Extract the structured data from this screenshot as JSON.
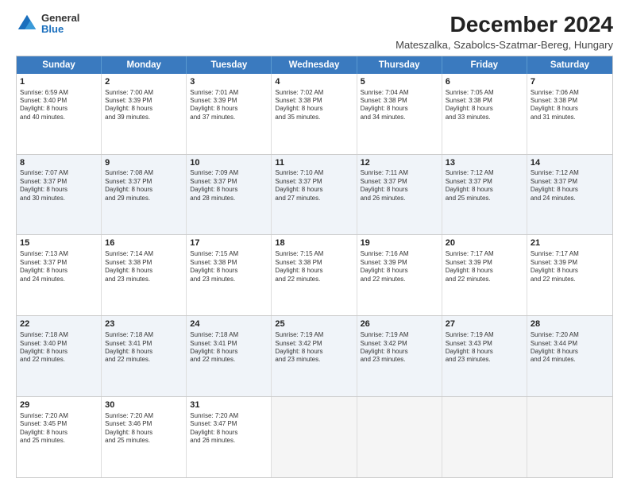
{
  "logo": {
    "general": "General",
    "blue": "Blue"
  },
  "title": "December 2024",
  "subtitle": "Mateszalka, Szabolcs-Szatmar-Bereg, Hungary",
  "calendar": {
    "headers": [
      "Sunday",
      "Monday",
      "Tuesday",
      "Wednesday",
      "Thursday",
      "Friday",
      "Saturday"
    ],
    "weeks": [
      [
        {
          "day": "1",
          "lines": [
            "Sunrise: 6:59 AM",
            "Sunset: 3:40 PM",
            "Daylight: 8 hours",
            "and 40 minutes."
          ]
        },
        {
          "day": "2",
          "lines": [
            "Sunrise: 7:00 AM",
            "Sunset: 3:39 PM",
            "Daylight: 8 hours",
            "and 39 minutes."
          ]
        },
        {
          "day": "3",
          "lines": [
            "Sunrise: 7:01 AM",
            "Sunset: 3:39 PM",
            "Daylight: 8 hours",
            "and 37 minutes."
          ]
        },
        {
          "day": "4",
          "lines": [
            "Sunrise: 7:02 AM",
            "Sunset: 3:38 PM",
            "Daylight: 8 hours",
            "and 35 minutes."
          ]
        },
        {
          "day": "5",
          "lines": [
            "Sunrise: 7:04 AM",
            "Sunset: 3:38 PM",
            "Daylight: 8 hours",
            "and 34 minutes."
          ]
        },
        {
          "day": "6",
          "lines": [
            "Sunrise: 7:05 AM",
            "Sunset: 3:38 PM",
            "Daylight: 8 hours",
            "and 33 minutes."
          ]
        },
        {
          "day": "7",
          "lines": [
            "Sunrise: 7:06 AM",
            "Sunset: 3:38 PM",
            "Daylight: 8 hours",
            "and 31 minutes."
          ]
        }
      ],
      [
        {
          "day": "8",
          "lines": [
            "Sunrise: 7:07 AM",
            "Sunset: 3:37 PM",
            "Daylight: 8 hours",
            "and 30 minutes."
          ]
        },
        {
          "day": "9",
          "lines": [
            "Sunrise: 7:08 AM",
            "Sunset: 3:37 PM",
            "Daylight: 8 hours",
            "and 29 minutes."
          ]
        },
        {
          "day": "10",
          "lines": [
            "Sunrise: 7:09 AM",
            "Sunset: 3:37 PM",
            "Daylight: 8 hours",
            "and 28 minutes."
          ]
        },
        {
          "day": "11",
          "lines": [
            "Sunrise: 7:10 AM",
            "Sunset: 3:37 PM",
            "Daylight: 8 hours",
            "and 27 minutes."
          ]
        },
        {
          "day": "12",
          "lines": [
            "Sunrise: 7:11 AM",
            "Sunset: 3:37 PM",
            "Daylight: 8 hours",
            "and 26 minutes."
          ]
        },
        {
          "day": "13",
          "lines": [
            "Sunrise: 7:12 AM",
            "Sunset: 3:37 PM",
            "Daylight: 8 hours",
            "and 25 minutes."
          ]
        },
        {
          "day": "14",
          "lines": [
            "Sunrise: 7:12 AM",
            "Sunset: 3:37 PM",
            "Daylight: 8 hours",
            "and 24 minutes."
          ]
        }
      ],
      [
        {
          "day": "15",
          "lines": [
            "Sunrise: 7:13 AM",
            "Sunset: 3:37 PM",
            "Daylight: 8 hours",
            "and 24 minutes."
          ]
        },
        {
          "day": "16",
          "lines": [
            "Sunrise: 7:14 AM",
            "Sunset: 3:38 PM",
            "Daylight: 8 hours",
            "and 23 minutes."
          ]
        },
        {
          "day": "17",
          "lines": [
            "Sunrise: 7:15 AM",
            "Sunset: 3:38 PM",
            "Daylight: 8 hours",
            "and 23 minutes."
          ]
        },
        {
          "day": "18",
          "lines": [
            "Sunrise: 7:15 AM",
            "Sunset: 3:38 PM",
            "Daylight: 8 hours",
            "and 22 minutes."
          ]
        },
        {
          "day": "19",
          "lines": [
            "Sunrise: 7:16 AM",
            "Sunset: 3:39 PM",
            "Daylight: 8 hours",
            "and 22 minutes."
          ]
        },
        {
          "day": "20",
          "lines": [
            "Sunrise: 7:17 AM",
            "Sunset: 3:39 PM",
            "Daylight: 8 hours",
            "and 22 minutes."
          ]
        },
        {
          "day": "21",
          "lines": [
            "Sunrise: 7:17 AM",
            "Sunset: 3:39 PM",
            "Daylight: 8 hours",
            "and 22 minutes."
          ]
        }
      ],
      [
        {
          "day": "22",
          "lines": [
            "Sunrise: 7:18 AM",
            "Sunset: 3:40 PM",
            "Daylight: 8 hours",
            "and 22 minutes."
          ]
        },
        {
          "day": "23",
          "lines": [
            "Sunrise: 7:18 AM",
            "Sunset: 3:41 PM",
            "Daylight: 8 hours",
            "and 22 minutes."
          ]
        },
        {
          "day": "24",
          "lines": [
            "Sunrise: 7:18 AM",
            "Sunset: 3:41 PM",
            "Daylight: 8 hours",
            "and 22 minutes."
          ]
        },
        {
          "day": "25",
          "lines": [
            "Sunrise: 7:19 AM",
            "Sunset: 3:42 PM",
            "Daylight: 8 hours",
            "and 23 minutes."
          ]
        },
        {
          "day": "26",
          "lines": [
            "Sunrise: 7:19 AM",
            "Sunset: 3:42 PM",
            "Daylight: 8 hours",
            "and 23 minutes."
          ]
        },
        {
          "day": "27",
          "lines": [
            "Sunrise: 7:19 AM",
            "Sunset: 3:43 PM",
            "Daylight: 8 hours",
            "and 23 minutes."
          ]
        },
        {
          "day": "28",
          "lines": [
            "Sunrise: 7:20 AM",
            "Sunset: 3:44 PM",
            "Daylight: 8 hours",
            "and 24 minutes."
          ]
        }
      ],
      [
        {
          "day": "29",
          "lines": [
            "Sunrise: 7:20 AM",
            "Sunset: 3:45 PM",
            "Daylight: 8 hours",
            "and 25 minutes."
          ]
        },
        {
          "day": "30",
          "lines": [
            "Sunrise: 7:20 AM",
            "Sunset: 3:46 PM",
            "Daylight: 8 hours",
            "and 25 minutes."
          ]
        },
        {
          "day": "31",
          "lines": [
            "Sunrise: 7:20 AM",
            "Sunset: 3:47 PM",
            "Daylight: 8 hours",
            "and 26 minutes."
          ]
        },
        {
          "day": "",
          "lines": []
        },
        {
          "day": "",
          "lines": []
        },
        {
          "day": "",
          "lines": []
        },
        {
          "day": "",
          "lines": []
        }
      ]
    ]
  }
}
